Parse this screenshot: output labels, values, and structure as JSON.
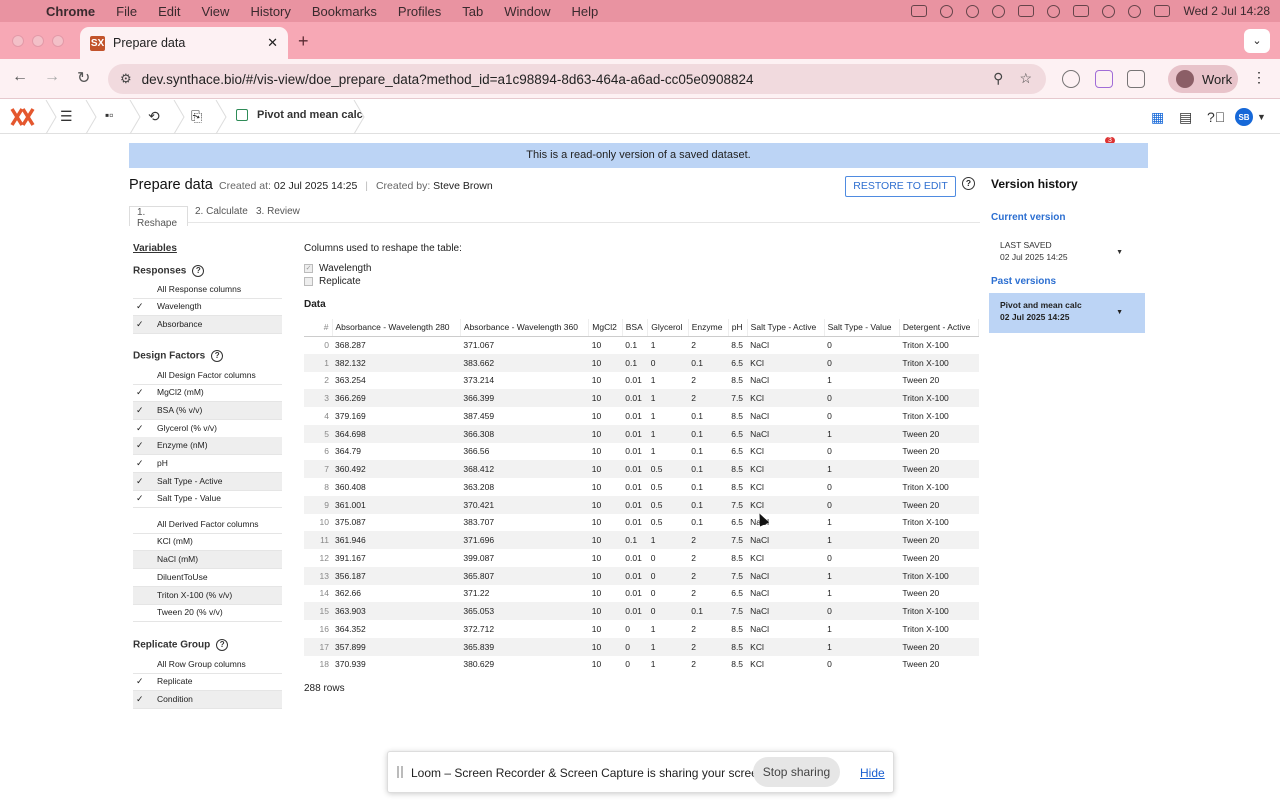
{
  "menubar": {
    "app": "Chrome",
    "items": [
      "File",
      "Edit",
      "View",
      "History",
      "Bookmarks",
      "Profiles",
      "Tab",
      "Window",
      "Help"
    ],
    "datetime": "Wed 2 Jul  14:28"
  },
  "browser": {
    "tab_title": "Prepare data",
    "url": "dev.synthace.bio/#/vis-view/doe_prepare_data?method_id=a1c98894-8d63-464a-a6ad-cc05e0908824",
    "extension_badge": "3",
    "profile_label": "Work"
  },
  "app_header": {
    "breadcrumb_current": "Pivot and mean calc",
    "avatar_initials": "SB"
  },
  "banner": "This is a read-only version of a saved dataset.",
  "page": {
    "title": "Prepare data",
    "created_at_label": "Created at:",
    "created_at": "02 Jul 2025 14:25",
    "created_by_label": "Created by:",
    "created_by": "Steve Brown",
    "restore_label": "RESTORE TO EDIT",
    "help": "?",
    "steps": [
      "1. Reshape",
      "2. Calculate",
      "3. Review"
    ]
  },
  "sidebar": {
    "variables": "Variables",
    "responses": {
      "title": "Responses",
      "all": "All Response columns",
      "items": [
        {
          "label": "Wavelength",
          "checked": true
        },
        {
          "label": "Absorbance",
          "checked": true
        }
      ]
    },
    "design_factors": {
      "title": "Design Factors",
      "all": "All Design Factor columns",
      "items": [
        {
          "label": "MgCl2 (mM)",
          "checked": true
        },
        {
          "label": "BSA (% v/v)",
          "checked": true
        },
        {
          "label": "Glycerol (% v/v)",
          "checked": true
        },
        {
          "label": "Enzyme (nM)",
          "checked": true
        },
        {
          "label": "pH",
          "checked": true
        },
        {
          "label": "Salt Type - Active",
          "checked": true
        },
        {
          "label": "Salt Type - Value",
          "checked": true
        }
      ],
      "derived_all": "All Derived Factor columns",
      "derived": [
        "KCl (mM)",
        "NaCl (mM)",
        "DiluentToUse",
        "Triton X-100 (% v/v)",
        "Tween 20 (% v/v)"
      ]
    },
    "replicate_group": {
      "title": "Replicate Group",
      "all": "All Row Group columns",
      "items": [
        {
          "label": "Replicate",
          "checked": true
        },
        {
          "label": "Condition",
          "checked": true
        }
      ]
    },
    "check": "✓"
  },
  "reshape": {
    "columns_used_label": "Columns used to reshape the table:",
    "columns": [
      "Wavelength",
      "Replicate"
    ],
    "data_label": "Data",
    "rows_count": "288 rows"
  },
  "table": {
    "headers": [
      "#",
      "Absorbance - Wavelength 280",
      "Absorbance - Wavelength 360",
      "MgCl2",
      "BSA",
      "Glycerol",
      "Enzyme",
      "pH",
      "Salt Type - Active",
      "Salt Type - Value",
      "Detergent - Active"
    ],
    "rows": [
      [
        "0",
        "368.287",
        "371.067",
        "10",
        "0.1",
        "1",
        "2",
        "8.5",
        "NaCl",
        "0",
        "Triton X-100"
      ],
      [
        "1",
        "382.132",
        "383.662",
        "10",
        "0.1",
        "0",
        "0.1",
        "6.5",
        "KCl",
        "0",
        "Triton X-100"
      ],
      [
        "2",
        "363.254",
        "373.214",
        "10",
        "0.01",
        "1",
        "2",
        "8.5",
        "NaCl",
        "1",
        "Tween 20"
      ],
      [
        "3",
        "366.269",
        "366.399",
        "10",
        "0.01",
        "1",
        "2",
        "7.5",
        "KCl",
        "0",
        "Triton X-100"
      ],
      [
        "4",
        "379.169",
        "387.459",
        "10",
        "0.01",
        "1",
        "0.1",
        "8.5",
        "NaCl",
        "0",
        "Triton X-100"
      ],
      [
        "5",
        "364.698",
        "366.308",
        "10",
        "0.01",
        "1",
        "0.1",
        "6.5",
        "NaCl",
        "1",
        "Tween 20"
      ],
      [
        "6",
        "364.79",
        "366.56",
        "10",
        "0.01",
        "1",
        "0.1",
        "6.5",
        "KCl",
        "0",
        "Tween 20"
      ],
      [
        "7",
        "360.492",
        "368.412",
        "10",
        "0.01",
        "0.5",
        "0.1",
        "8.5",
        "KCl",
        "1",
        "Tween 20"
      ],
      [
        "8",
        "360.408",
        "363.208",
        "10",
        "0.01",
        "0.5",
        "0.1",
        "8.5",
        "KCl",
        "0",
        "Triton X-100"
      ],
      [
        "9",
        "361.001",
        "370.421",
        "10",
        "0.01",
        "0.5",
        "0.1",
        "7.5",
        "KCl",
        "0",
        "Tween 20"
      ],
      [
        "10",
        "375.087",
        "383.707",
        "10",
        "0.01",
        "0.5",
        "0.1",
        "6.5",
        "NaCl",
        "1",
        "Triton X-100"
      ],
      [
        "11",
        "361.946",
        "371.696",
        "10",
        "0.1",
        "1",
        "2",
        "7.5",
        "NaCl",
        "1",
        "Tween 20"
      ],
      [
        "12",
        "391.167",
        "399.087",
        "10",
        "0.01",
        "0",
        "2",
        "8.5",
        "KCl",
        "0",
        "Tween 20"
      ],
      [
        "13",
        "356.187",
        "365.807",
        "10",
        "0.01",
        "0",
        "2",
        "7.5",
        "NaCl",
        "1",
        "Triton X-100"
      ],
      [
        "14",
        "362.66",
        "371.22",
        "10",
        "0.01",
        "0",
        "2",
        "6.5",
        "NaCl",
        "1",
        "Tween 20"
      ],
      [
        "15",
        "363.903",
        "365.053",
        "10",
        "0.01",
        "0",
        "0.1",
        "7.5",
        "NaCl",
        "0",
        "Triton X-100"
      ],
      [
        "16",
        "364.352",
        "372.712",
        "10",
        "0",
        "1",
        "2",
        "8.5",
        "NaCl",
        "1",
        "Triton X-100"
      ],
      [
        "17",
        "357.899",
        "365.839",
        "10",
        "0",
        "1",
        "2",
        "8.5",
        "KCl",
        "1",
        "Tween 20"
      ],
      [
        "18",
        "370.939",
        "380.629",
        "10",
        "0",
        "1",
        "2",
        "8.5",
        "KCl",
        "0",
        "Tween 20"
      ]
    ]
  },
  "version_history": {
    "title": "Version history",
    "current_label": "Current version",
    "current": {
      "name": "LAST SAVED",
      "date": "02 Jul 2025 14:25"
    },
    "past_label": "Past versions",
    "past": [
      {
        "name": "Pivot and mean calc",
        "date": "02 Jul 2025 14:25"
      }
    ]
  },
  "loom": {
    "message": "Loom – Screen Recorder & Screen Capture is sharing your screen.",
    "stop_label": "Stop sharing",
    "hide_label": "Hide"
  },
  "colors": {
    "banner": "#bcd4f5",
    "accent": "#2c6fd1",
    "tabstrip": "#f7a8b5",
    "menubar": "#e993a1"
  }
}
